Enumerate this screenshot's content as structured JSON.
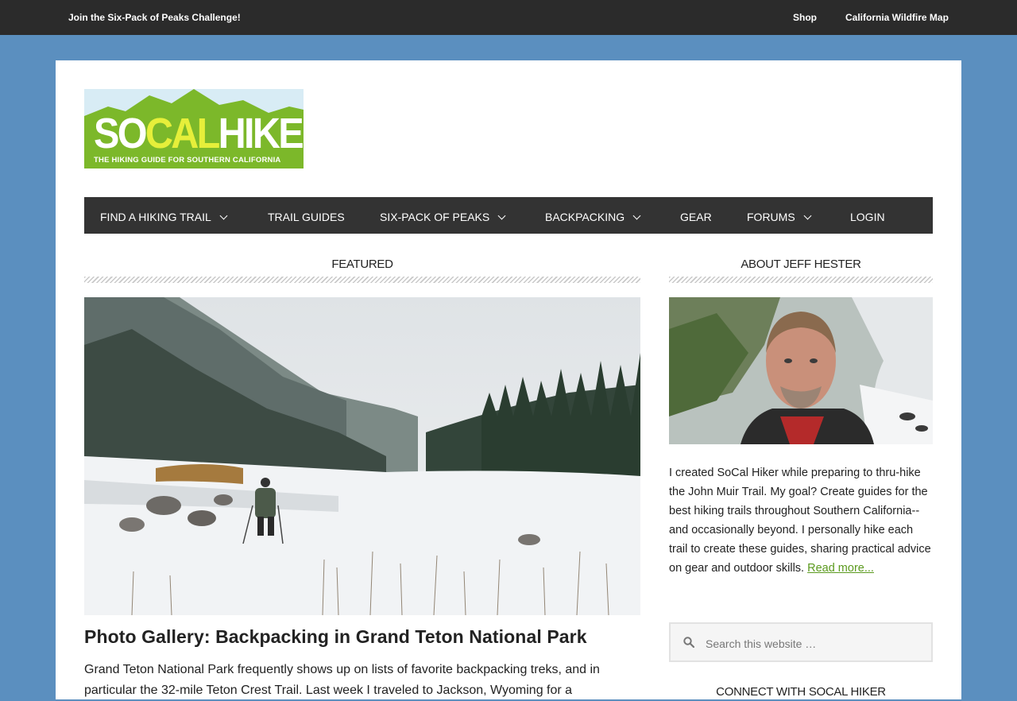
{
  "topbar": {
    "challenge_link": "Join the Six-Pack of Peaks Challenge!",
    "shop_link": "Shop",
    "wildfire_link": "California Wildfire Map"
  },
  "logo": {
    "word_so": "SO",
    "word_cal": "CAL",
    "word_hiker": "HIKER",
    "tagline": "THE HIKING GUIDE FOR SOUTHERN CALIFORNIA"
  },
  "nav": {
    "items": [
      {
        "label": "FIND A HIKING TRAIL",
        "has_dropdown": true
      },
      {
        "label": "TRAIL GUIDES",
        "has_dropdown": false
      },
      {
        "label": "SIX-PACK OF PEAKS",
        "has_dropdown": true
      },
      {
        "label": "BACKPACKING",
        "has_dropdown": true
      },
      {
        "label": "GEAR",
        "has_dropdown": false
      },
      {
        "label": "FORUMS",
        "has_dropdown": true
      },
      {
        "label": "LOGIN",
        "has_dropdown": false
      }
    ]
  },
  "featured": {
    "heading": "FEATURED",
    "post_title": "Photo Gallery: Backpacking in Grand Teton National Park",
    "excerpt": "Grand Teton National Park frequently shows up on lists of favorite backpacking treks, and in particular the 32-mile Teton Crest Trail. Last week I traveled to Jackson, Wyoming for a"
  },
  "sidebar": {
    "about_heading": "ABOUT JEFF HESTER",
    "bio_text": "I created SoCal Hiker while preparing to thru-hike the John Muir Trail. My goal? Create guides for the best hiking trails throughout Southern California--and occasionally beyond. I personally hike each trail to create these guides, sharing practical advice on gear and outdoor skills. ",
    "read_more": "Read more...",
    "search_placeholder": "Search this website …",
    "connect_heading": "CONNECT WITH SOCAL HIKER"
  },
  "colors": {
    "page_background": "#5b8fbf",
    "topbar": "#2b2b2b",
    "nav": "#333333",
    "logo_green": "#7cb82a",
    "link_green": "#5b9a1e"
  }
}
